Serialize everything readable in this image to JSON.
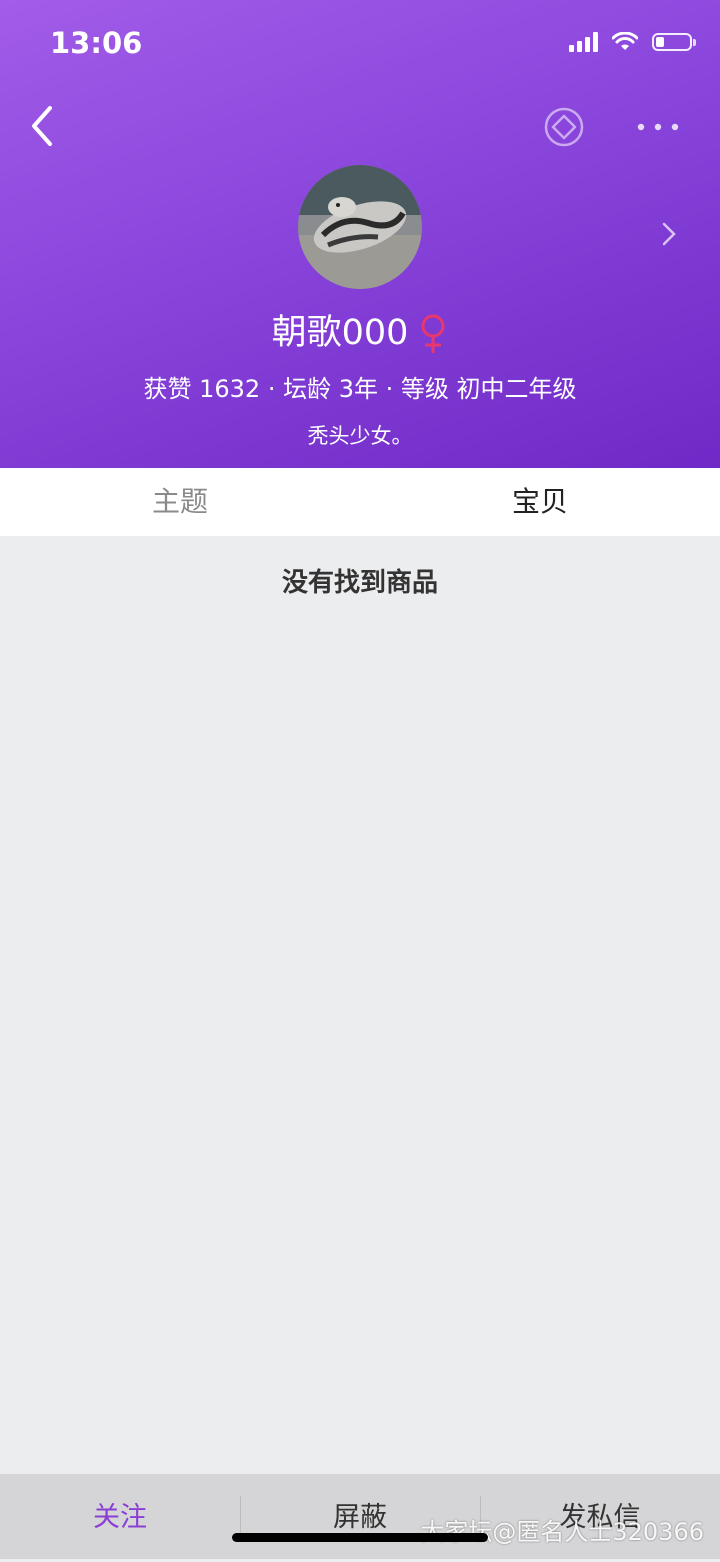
{
  "status_bar": {
    "time": "13:06",
    "battery_percent": 25
  },
  "profile": {
    "name": "朝歌000",
    "stats": "获赞 1632 · 坛龄 3年 · 等级 初中二年级",
    "bio": "秃头少女。"
  },
  "tabs": [
    {
      "label": "主题",
      "active": false
    },
    {
      "label": "宝贝",
      "active": true
    }
  ],
  "content": {
    "empty_message": "没有找到商品"
  },
  "bottom_bar": {
    "follow": "关注",
    "block": "屏蔽",
    "message": "发私信"
  },
  "watermark": "大家坛@匿名人士320366",
  "colors": {
    "accent": "#8a3fd4",
    "gender_female": "#e8386b"
  },
  "icons": [
    "back-icon",
    "diamond-icon",
    "more-icon",
    "chevron-right-icon",
    "female-icon",
    "signal-icon",
    "wifi-icon",
    "battery-icon"
  ]
}
